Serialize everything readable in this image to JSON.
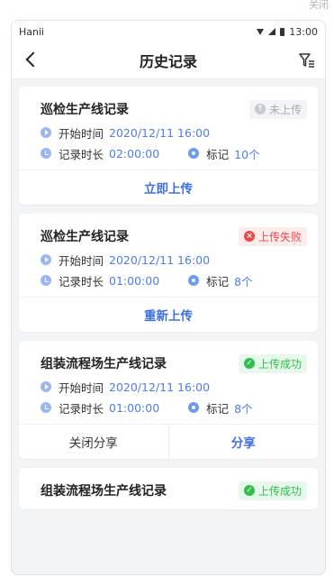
{
  "top_hint": "关闭",
  "statusbar": {
    "carrier": "Hanii",
    "time": "13:00"
  },
  "nav": {
    "title": "历史记录"
  },
  "labels": {
    "start": "开始时间",
    "duration": "记录时长",
    "marks": "标记"
  },
  "records": [
    {
      "title": "巡检生产线记录",
      "status": "未上传",
      "start": "2020/12/11  16:00",
      "duration": "02:00:00",
      "marks": "10个",
      "action": "立即上传"
    },
    {
      "title": "巡检生产线记录",
      "status": "上传失败",
      "start": "2020/12/11  16:00",
      "duration": "01:00:00",
      "marks": "8个",
      "action": "重新上传"
    },
    {
      "title": "组装流程场生产线记录",
      "status": "上传成功",
      "start": "2020/12/11  16:00",
      "duration": "01:00:00",
      "marks": "8个",
      "action_left": "关闭分享",
      "action_right": "分享"
    },
    {
      "title": "组装流程场生产线记录",
      "status": "上传成功"
    }
  ],
  "colors": {
    "accent": "#3c6fe6",
    "value": "#4d7dee",
    "fail": "#e84a4a",
    "success": "#2fbf4a",
    "pending": "#a8abb2"
  }
}
